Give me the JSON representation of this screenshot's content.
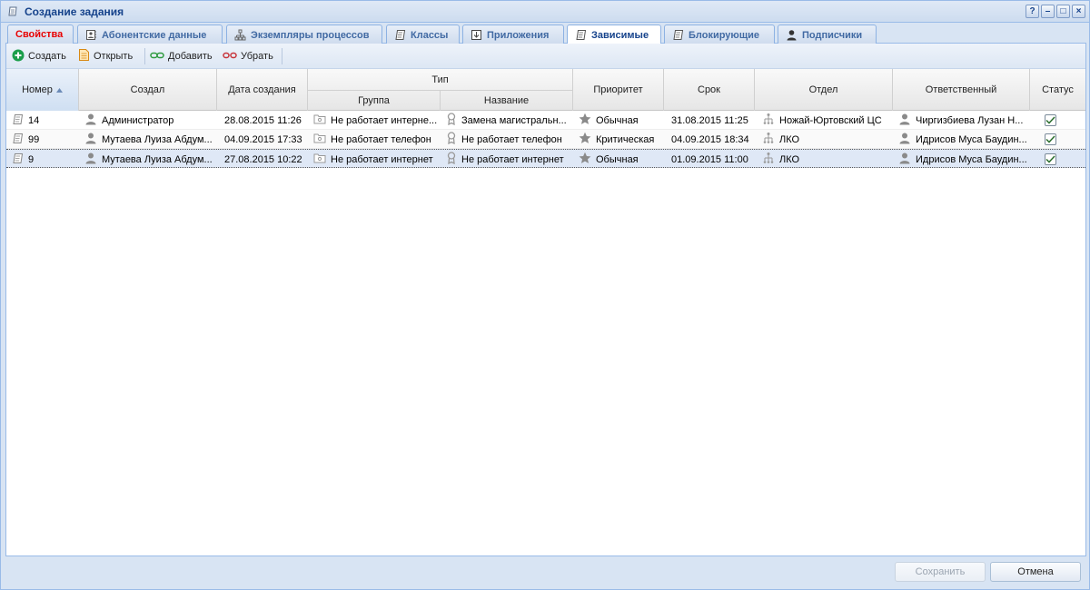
{
  "window": {
    "title": "Создание задания"
  },
  "title_tools": [
    "?",
    "–",
    "□",
    "×"
  ],
  "tabs": [
    {
      "label": "Свойства",
      "icon": "none",
      "state": "red"
    },
    {
      "label": "Абонентские данные",
      "icon": "contact-card-icon",
      "state": "normal"
    },
    {
      "label": "Экземпляры процессов",
      "icon": "process-tree-icon",
      "state": "normal"
    },
    {
      "label": "Классы",
      "icon": "scroll-icon",
      "state": "normal"
    },
    {
      "label": "Приложения",
      "icon": "download-box-icon",
      "state": "normal"
    },
    {
      "label": "Зависимые",
      "icon": "scroll-icon",
      "state": "active"
    },
    {
      "label": "Блокирующие",
      "icon": "scroll-icon",
      "state": "normal"
    },
    {
      "label": "Подписчики",
      "icon": "user-icon",
      "state": "normal"
    }
  ],
  "toolbar": {
    "create": "Создать",
    "open": "Открыть",
    "add": "Добавить",
    "remove": "Убрать"
  },
  "grid": {
    "headers": {
      "number": "Номер",
      "creator": "Создал",
      "created": "Дата создания",
      "type": "Тип",
      "group": "Группа",
      "name": "Название",
      "priority": "Приоритет",
      "due": "Срок",
      "department": "Отдел",
      "responsible": "Ответственный",
      "status": "Статус"
    },
    "rows": [
      {
        "number": "14",
        "creator": "Администратор",
        "created": "28.08.2015 11:26",
        "group": "Не работает интерне...",
        "name": "Замена магистральн...",
        "priority": "Обычная",
        "due": "31.08.2015 11:25",
        "department": "Ножай-Юртовский ЦС",
        "responsible": "Чиргизбиева Лузан Н...",
        "status": true
      },
      {
        "number": "99",
        "creator": "Мутаева Луиза Абдум...",
        "created": "04.09.2015 17:33",
        "group": "Не работает телефон",
        "name": "Не работает телефон",
        "priority": "Критическая",
        "due": "04.09.2015 18:34",
        "department": "ЛКО",
        "responsible": "Идрисов Муса Баудин...",
        "status": true
      },
      {
        "number": "9",
        "creator": "Мутаева Луиза Абдум...",
        "created": "27.08.2015 10:22",
        "group": "Не работает интернет",
        "name": "Не работает интернет",
        "priority": "Обычная",
        "due": "01.09.2015 11:00",
        "department": "ЛКО",
        "responsible": "Идрисов Муса Баудин...",
        "status": true
      }
    ]
  },
  "footer": {
    "save": "Сохранить",
    "cancel": "Отмена"
  },
  "colors": {
    "accent": "#15428b",
    "tab_red": "#e80000",
    "selection": "#dfe8f6",
    "add_green": "#1b9e4b"
  }
}
